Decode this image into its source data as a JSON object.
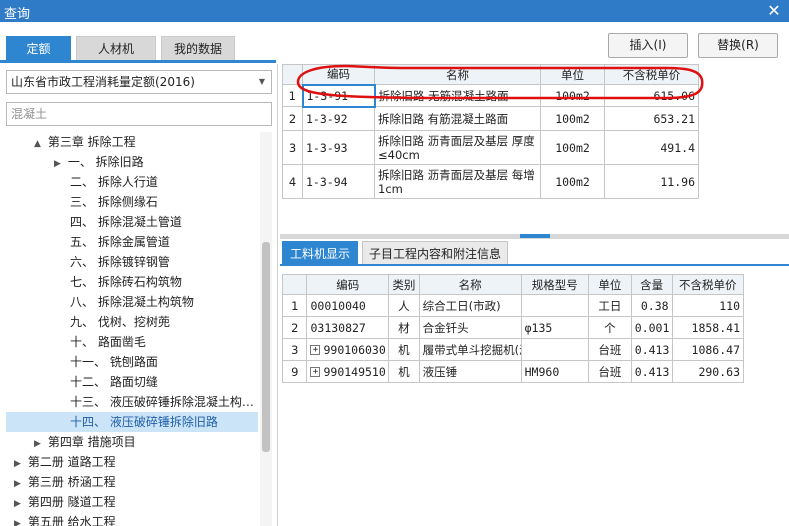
{
  "window": {
    "title": "查询",
    "close_icon": "close-icon"
  },
  "tabs": [
    {
      "label": "定额",
      "active": true
    },
    {
      "label": "人材机",
      "active": false
    },
    {
      "label": "我的数据",
      "active": false
    }
  ],
  "buttons": {
    "insert": "插入(I)",
    "replace": "替换(R)"
  },
  "left": {
    "quota_select": "山东省市政工程消耗量定额(2016)",
    "search_value": "混凝土",
    "tree": [
      {
        "label": "第三章 拆除工程",
        "level": 1,
        "toggle": "▲"
      },
      {
        "label": "一、 拆除旧路",
        "level": 2,
        "toggle": "▶"
      },
      {
        "label": "二、 拆除人行道",
        "level": 2
      },
      {
        "label": "三、 拆除侧缘石",
        "level": 2
      },
      {
        "label": "四、 拆除混凝土管道",
        "level": 2
      },
      {
        "label": "五、 拆除金属管道",
        "level": 2
      },
      {
        "label": "六、 拆除镀锌钢管",
        "level": 2
      },
      {
        "label": "七、 拆除砖石构筑物",
        "level": 2
      },
      {
        "label": "八、 拆除混凝土构筑物",
        "level": 2
      },
      {
        "label": "九、 伐树、挖树蔸",
        "level": 2
      },
      {
        "label": "十、 路面凿毛",
        "level": 2
      },
      {
        "label": "十一、 铣刨路面",
        "level": 2
      },
      {
        "label": "十二、 路面切缝",
        "level": 2
      },
      {
        "label": "十三、 液压破碎锤拆除混凝土构…",
        "level": 2
      },
      {
        "label": "十四、 液压破碎锤拆除旧路",
        "level": 2,
        "selected": true
      },
      {
        "label": "第四章 措施项目",
        "level": 1,
        "toggle": "▶"
      },
      {
        "label": "第二册 道路工程",
        "level": 0,
        "toggle": "▶"
      },
      {
        "label": "第三册 桥涵工程",
        "level": 0,
        "toggle": "▶"
      },
      {
        "label": "第四册 隧道工程",
        "level": 0,
        "toggle": "▶"
      },
      {
        "label": "第五册 给水工程",
        "level": 0,
        "toggle": "▶"
      }
    ]
  },
  "quota_table": {
    "headers": [
      "编码",
      "名称",
      "单位",
      "不含税单价"
    ],
    "rows": [
      {
        "idx": "1",
        "code": "1-3-91",
        "name": "拆除旧路 无筋混凝土路面",
        "unit": "100m2",
        "price": "615.06"
      },
      {
        "idx": "2",
        "code": "1-3-92",
        "name": "拆除旧路 有筋混凝土路面",
        "unit": "100m2",
        "price": "653.21"
      },
      {
        "idx": "3",
        "code": "1-3-93",
        "name": "拆除旧路 沥青面层及基层 厚度≤40cm",
        "unit": "100m2",
        "price": "491.4"
      },
      {
        "idx": "4",
        "code": "1-3-94",
        "name": "拆除旧路 沥青面层及基层 每增1cm",
        "unit": "100m2",
        "price": "11.96"
      }
    ]
  },
  "bottom_tabs": [
    {
      "label": "工料机显示",
      "active": true
    },
    {
      "label": "子目工程内容和附注信息",
      "active": false
    }
  ],
  "resource_table": {
    "headers": [
      "编码",
      "类别",
      "名称",
      "规格型号",
      "单位",
      "含量",
      "不含税单价"
    ],
    "rows": [
      {
        "idx": "1",
        "expand": false,
        "code": "00010040",
        "cat": "人",
        "name": "综合工日(市政)",
        "spec": "",
        "unit": "工日",
        "qty": "0.38",
        "price": "110"
      },
      {
        "idx": "2",
        "expand": false,
        "code": "03130827",
        "cat": "材",
        "name": "合金钎头",
        "spec": "φ135",
        "unit": "个",
        "qty": "0.001",
        "price": "1858.41"
      },
      {
        "idx": "3",
        "expand": true,
        "code": "990106030",
        "cat": "机",
        "name": "履带式单斗挖掘机(液压)…",
        "spec": "",
        "unit": "台班",
        "qty": "0.413",
        "price": "1086.47"
      },
      {
        "idx": "9",
        "expand": true,
        "code": "990149510",
        "cat": "机",
        "name": "液压锤",
        "spec": "HM960",
        "unit": "台班",
        "qty": "0.413",
        "price": "290.63"
      }
    ]
  },
  "colors": {
    "accent": "#2e86d1",
    "titlebar": "#2f7bc8",
    "annotation": "#e01010"
  }
}
